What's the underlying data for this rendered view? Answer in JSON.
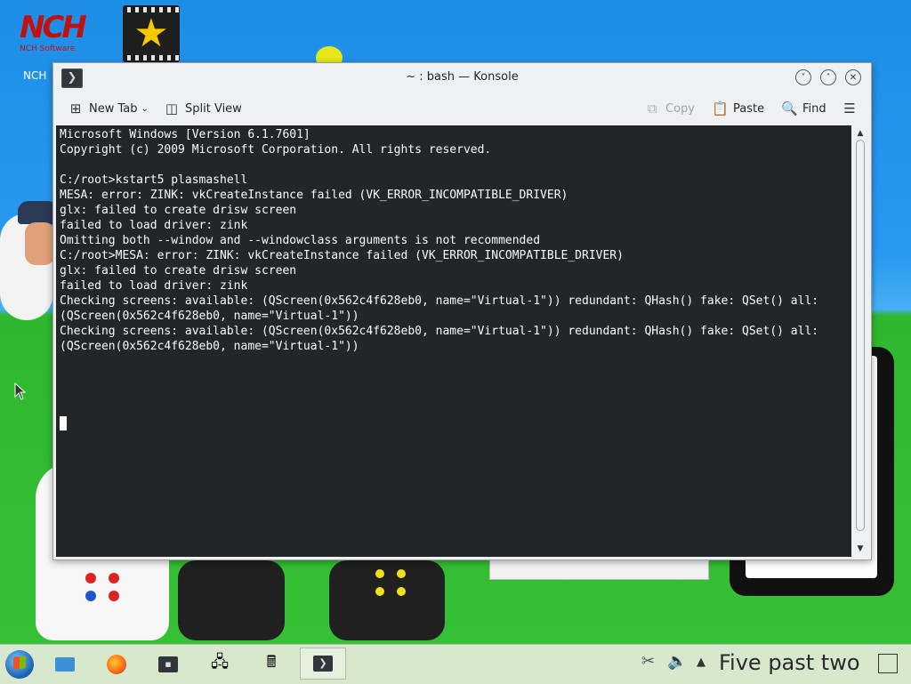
{
  "desktop": {
    "icons": [
      {
        "name": "nch-software",
        "label": "NCH",
        "logo_text": "NCH",
        "logo_subtext": "NCH Software"
      },
      {
        "name": "videopad",
        "label": ""
      }
    ]
  },
  "window": {
    "title": "~ : bash — Konsole",
    "app_icon": "terminal-icon",
    "buttons": {
      "minimize": "˅",
      "maximize": "˄",
      "close": "✕"
    }
  },
  "toolbar": {
    "new_tab_label": "New Tab",
    "split_view_label": "Split View",
    "copy_label": "Copy",
    "paste_label": "Paste",
    "find_label": "Find",
    "copy_enabled": false
  },
  "terminal": {
    "background": "#232627",
    "foreground": "#fcfcfc",
    "lines": [
      "Microsoft Windows [Version 6.1.7601]",
      "Copyright (c) 2009 Microsoft Corporation. All rights reserved.",
      "",
      "C:/root>kstart5 plasmashell",
      "MESA: error: ZINK: vkCreateInstance failed (VK_ERROR_INCOMPATIBLE_DRIVER)",
      "glx: failed to create drisw screen",
      "failed to load driver: zink",
      "Omitting both --window and --windowclass arguments is not recommended",
      "C:/root>MESA: error: ZINK: vkCreateInstance failed (VK_ERROR_INCOMPATIBLE_DRIVER)",
      "glx: failed to create drisw screen",
      "failed to load driver: zink",
      "Checking screens: available: (QScreen(0x562c4f628eb0, name=\"Virtual-1\")) redundant: QHash() fake: QSet() all:",
      "(QScreen(0x562c4f628eb0, name=\"Virtual-1\"))",
      "Checking screens: available: (QScreen(0x562c4f628eb0, name=\"Virtual-1\")) redundant: QHash() fake: QSet() all:",
      "(QScreen(0x562c4f628eb0, name=\"Virtual-1\"))"
    ]
  },
  "taskbar": {
    "items": [
      "start-button",
      "file-manager",
      "firefox",
      "terminal",
      "network-settings",
      "calculator",
      "konsole"
    ],
    "active_item": "konsole",
    "clock": "Five past two"
  }
}
